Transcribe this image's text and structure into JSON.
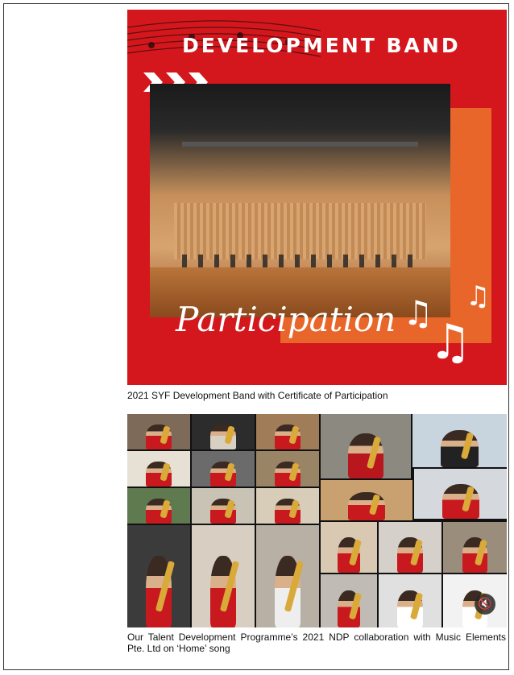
{
  "poster": {
    "title": "DEVELOPMENT BAND",
    "script_text": "Participation",
    "colors": {
      "background": "#d3171d",
      "accent": "#ea6f2b"
    }
  },
  "caption1": "2021 SYF Development Band with Certificate of Participation",
  "collage": {
    "mute_icon": "speaker-mute-icon",
    "tiles": [
      {
        "bg": "#7e6a58",
        "shirt": "#c8191f"
      },
      {
        "bg": "#2c2c2c",
        "shirt": "#d9d0c4"
      },
      {
        "bg": "#a07c58",
        "shirt": "#c8191f"
      },
      {
        "bg": "#8c8a80",
        "shirt": "#b8171d"
      },
      {
        "bg": "#c8d4de",
        "shirt": "#222222"
      },
      {
        "bg": "#e7e1d5",
        "shirt": "#c8191f"
      },
      {
        "bg": "#6b6b6b",
        "shirt": "#c8191f"
      },
      {
        "bg": "#9a8466",
        "shirt": "#c8191f"
      },
      {
        "bg": "#5e7a4e",
        "shirt": "#c8191f"
      },
      {
        "bg": "#c9c3b6",
        "shirt": "#c8191f"
      },
      {
        "bg": "#d8cdb8",
        "shirt": "#c8191f"
      },
      {
        "bg": "#c9a070",
        "shirt": "#c8191f"
      },
      {
        "bg": "#d5d8dd",
        "shirt": "#c8191f"
      },
      {
        "bg": "#3b3b3b",
        "shirt": "#c8191f"
      },
      {
        "bg": "#d8cfc2",
        "shirt": "#c8191f"
      },
      {
        "bg": "#b8b0a5",
        "shirt": "#eeeeee"
      },
      {
        "bg": "#d9c9b2",
        "shirt": "#c8191f"
      },
      {
        "bg": "#d5d0c9",
        "shirt": "#c8191f"
      },
      {
        "bg": "#9b8d7b",
        "shirt": "#c8191f"
      },
      {
        "bg": "#c0bcb5",
        "shirt": "#c8191f"
      },
      {
        "bg": "#e0e0e0",
        "shirt": "#ffffff"
      },
      {
        "bg": "#f2f2f2",
        "shirt": "#ffffff"
      }
    ]
  },
  "caption2": "Our Talent Development Programme’s 2021 NDP collaboration with Music Elements Pte. Ltd on ‘Home’ song"
}
